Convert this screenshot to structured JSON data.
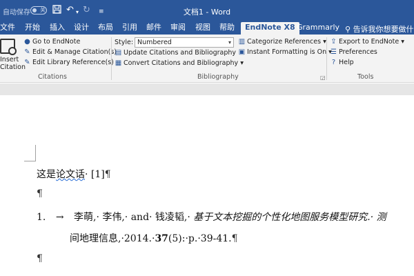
{
  "titlebar": {
    "autosave_label": "自动保存",
    "autosave_state": "关",
    "save_icon": "save-icon",
    "undo_icon": "undo-icon",
    "redo_icon": "redo-icon",
    "customize_icon": "customize-qat-icon",
    "doc_title": "文档1 - Word",
    "bg_color": "#2b579a"
  },
  "tabs": {
    "file": "文件",
    "home": "开始",
    "insert": "插入",
    "design": "设计",
    "layout": "布局",
    "references": "引用",
    "mailings": "邮件",
    "review": "审阅",
    "view": "视图",
    "help": "帮助",
    "endnote": "EndNote X8",
    "grammarly": "Grammarly",
    "search_hint": "告诉我你想要做什么"
  },
  "ribbon": {
    "citations": {
      "insert_label_1": "Insert",
      "insert_label_2": "Citation",
      "go_to_endnote": "Go to EndNote",
      "edit_manage": "Edit & Manage Citation(s)",
      "edit_library": "Edit Library Reference(s)",
      "group_label": "Citations"
    },
    "bibliography": {
      "style_label": "Style:",
      "style_value": "Numbered",
      "update": "Update Citations and Bibliography",
      "convert": "Convert Citations and Bibliography",
      "categorize": "Categorize References",
      "instant": "Instant Formatting is On",
      "group_label": "Bibliography"
    },
    "tools": {
      "export": "Export to EndNote",
      "preferences": "Preferences",
      "help": "Help",
      "group_label": "Tools"
    }
  },
  "document": {
    "line1_prefix": "这是",
    "line1_underlined": "论文话",
    "line1_suffix": "· [1]",
    "pilcrow": "¶",
    "ref_number": "1.",
    "ref_tab": "→",
    "ref_authors": "李萌,· 李伟,· and· 钱凌韬,· ",
    "ref_title": "基于文本挖掘的个性化地图服务模型研究.· 测",
    "ref_line2_prefix": "间地理信息,·2014.·",
    "ref_volume": "37",
    "ref_line2_suffix": "(5):·p.·39-41."
  }
}
